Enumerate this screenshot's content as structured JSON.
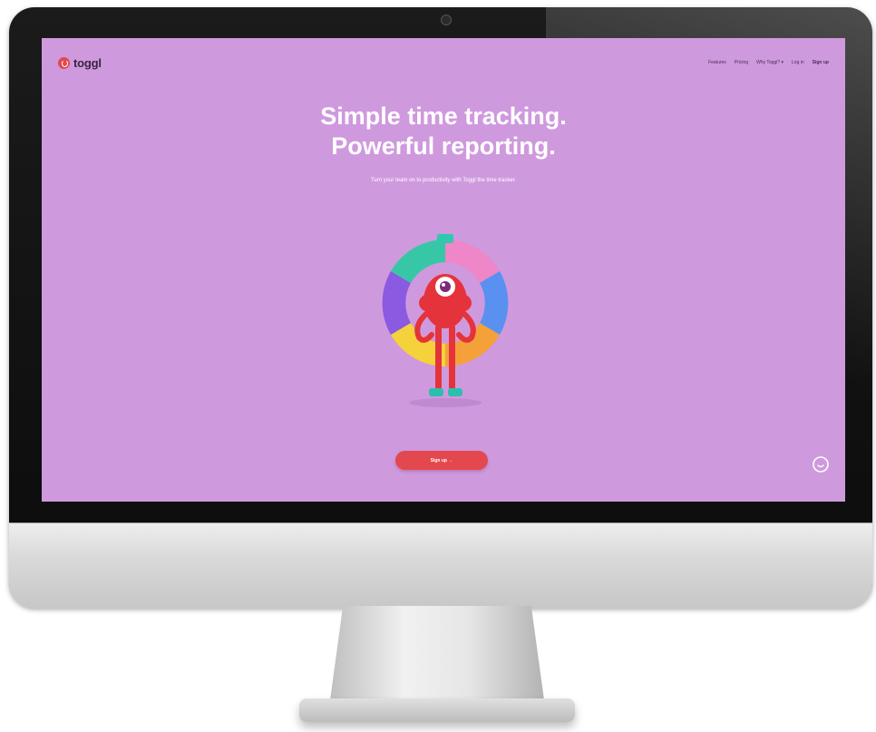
{
  "nav": {
    "logo_text": "toggl",
    "links": [
      {
        "label": "Features"
      },
      {
        "label": "Pricing"
      },
      {
        "label": "Why Toggl? ▾"
      },
      {
        "label": "Log in"
      },
      {
        "label": "Sign up"
      }
    ]
  },
  "hero": {
    "title_line1": "Simple time tracking.",
    "title_line2": "Powerful reporting.",
    "subtitle": "Turn your team on to productivity with Toggl the time tracker.",
    "cta_label": "Sign up →"
  },
  "icons": {
    "logo": "toggl-logo-icon",
    "chat": "chat-bubble-icon",
    "mascot": "toggl-mascot-illustration"
  },
  "colors": {
    "screen_background": "#cf99de",
    "accent": "#e3484f",
    "text": "#ffffff"
  }
}
